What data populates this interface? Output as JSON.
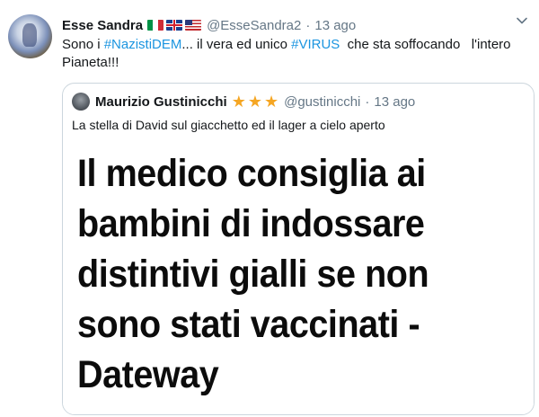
{
  "tweet": {
    "display_name": "Esse Sandra",
    "flags": [
      "italy-flag",
      "uk-flag",
      "us-flag"
    ],
    "handle": "@EsseSandra2",
    "separator": "·",
    "time": "13 ago",
    "text_parts": [
      {
        "text": "Sono i ",
        "link": false
      },
      {
        "text": "#NazistiDEM",
        "link": true
      },
      {
        "text": "... il vera ed unico ",
        "link": false
      },
      {
        "text": "#VIRUS",
        "link": true
      },
      {
        "text": "  che sta soffocando   l'intero Pianeta!!!",
        "link": false
      }
    ],
    "caret_icon": "chevron-down-icon"
  },
  "quote": {
    "display_name": "Maurizio Gustinicchi",
    "stars": 3,
    "handle": "@gustinicchi",
    "separator": "·",
    "time": "13 ago",
    "text": "La stella di David sul giacchetto ed il lager a cielo aperto",
    "image_headline": "Il medico consiglia ai bambini di indossare distintivi gialli se non sono stati vaccinati - Dateway"
  },
  "colors": {
    "link": "#1b95e0",
    "muted": "#657786",
    "star": "#f5a623",
    "border": "#ccd6dd"
  }
}
